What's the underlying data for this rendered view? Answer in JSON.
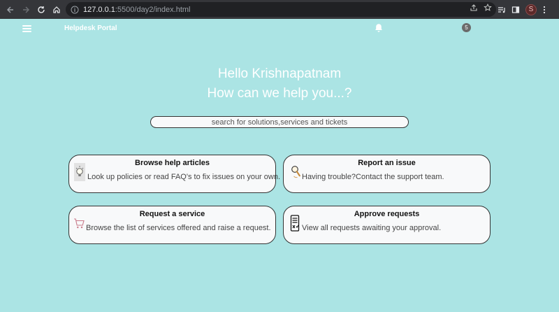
{
  "browser": {
    "url_host": "127.0.0.1",
    "url_rest": ":5500/day2/index.html",
    "profile_initial": "S"
  },
  "header": {
    "brand": "Helpdesk Portal",
    "notification_count": "5"
  },
  "hero": {
    "line1": "Hello Krishnapatnam",
    "line2": "How can we help you...?"
  },
  "search": {
    "placeholder": "search for solutions,services and tickets"
  },
  "cards": [
    {
      "title": "Browse help articles",
      "desc": "Look up policies or read FAQ's to fix issues on your own.",
      "icon": "lightbulb-icon"
    },
    {
      "title": "Report an issue",
      "desc": "Having trouble?Contact the support team.",
      "icon": "magnifier-icon"
    },
    {
      "title": "Request a service",
      "desc": "Browse the list of services offered and raise a request.",
      "icon": "cart-icon"
    },
    {
      "title": "Approve requests",
      "desc": "View all requests awaiting your approval.",
      "icon": "checklist-icon"
    }
  ]
}
